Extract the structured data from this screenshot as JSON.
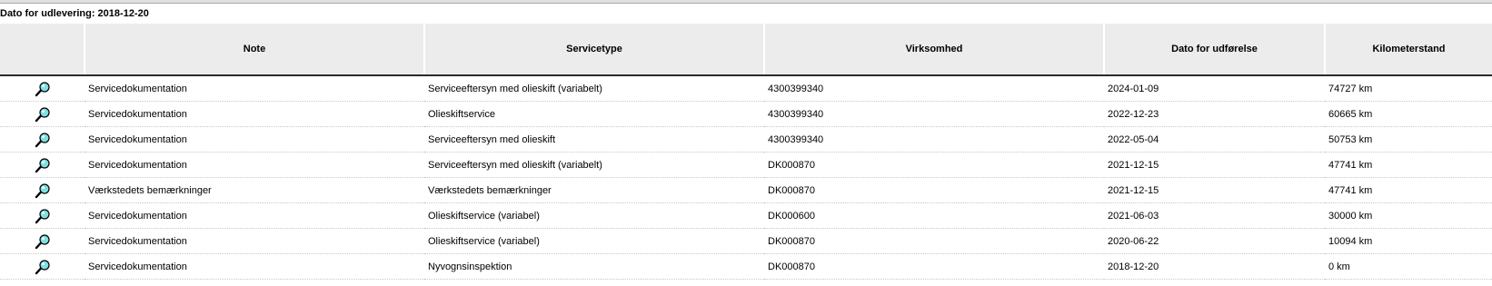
{
  "delivery": {
    "text": "Dato for udlevering: 2018-12-20"
  },
  "table": {
    "headers": [
      "",
      "Note",
      "Servicetype",
      "Virksomhed",
      "Dato for udførelse",
      "Kilometerstand"
    ],
    "rows": [
      {
        "note": "Servicedokumentation",
        "servicetype": "Serviceeftersyn med olieskift (variabelt)",
        "virksomhed": "4300399340",
        "dato": "2024-01-09",
        "km": "74727 km"
      },
      {
        "note": "Servicedokumentation",
        "servicetype": "Olieskiftservice",
        "virksomhed": "4300399340",
        "dato": "2022-12-23",
        "km": "60665 km"
      },
      {
        "note": "Servicedokumentation",
        "servicetype": "Serviceeftersyn med olieskift",
        "virksomhed": "4300399340",
        "dato": "2022-05-04",
        "km": "50753 km"
      },
      {
        "note": "Servicedokumentation",
        "servicetype": "Serviceeftersyn med olieskift (variabelt)",
        "virksomhed": "DK000870",
        "dato": "2021-12-15",
        "km": "47741 km"
      },
      {
        "note": "Værkstedets bemærkninger",
        "servicetype": "Værkstedets bemærkninger",
        "virksomhed": "DK000870",
        "dato": "2021-12-15",
        "km": "47741 km"
      },
      {
        "note": "Servicedokumentation",
        "servicetype": "Olieskiftservice (variabel)",
        "virksomhed": "DK000600",
        "dato": "2021-06-03",
        "km": "30000 km"
      },
      {
        "note": "Servicedokumentation",
        "servicetype": "Olieskiftservice (variabel)",
        "virksomhed": "DK000870",
        "dato": "2020-06-22",
        "km": "10094 km"
      },
      {
        "note": "Servicedokumentation",
        "servicetype": "Nyvognsinspektion",
        "virksomhed": "DK000870",
        "dato": "2018-12-20",
        "km": "0 km"
      }
    ]
  },
  "icons": {
    "row_view": "magnifier-icon"
  },
  "colors": {
    "header_bg": "#ececec",
    "icon_lens": "#7fe0e0"
  }
}
